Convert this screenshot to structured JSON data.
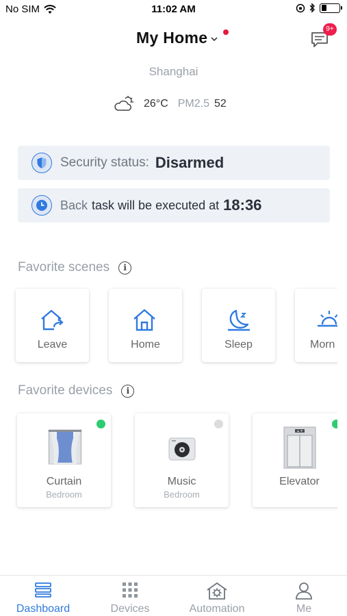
{
  "status_bar": {
    "carrier": "No SIM",
    "time": "11:02 AM",
    "battery_level": 0.3
  },
  "header": {
    "title": "My Home",
    "unread_badge": "9+"
  },
  "location": {
    "city": "Shanghai",
    "weather_icon": "partly-cloudy-icon",
    "temperature": "26°C",
    "pm_label": "PM2.5",
    "pm_value": "52"
  },
  "security": {
    "label": "Security status:",
    "value": "Disarmed"
  },
  "task": {
    "prefix": "Back",
    "text": "task will be executed at",
    "time": "18:36"
  },
  "scenes": {
    "title": "Favorite scenes",
    "items": [
      {
        "label": "Leave",
        "icon": "leave-home-icon"
      },
      {
        "label": "Home",
        "icon": "home-icon"
      },
      {
        "label": "Sleep",
        "icon": "moon-icon"
      },
      {
        "label": "Morn",
        "icon": "sunrise-icon"
      }
    ]
  },
  "devices": {
    "title": "Favorite devices",
    "items": [
      {
        "name": "Curtain",
        "room": "Bedroom",
        "icon": "curtain-icon",
        "status": "online",
        "status_color": "#2ecc71"
      },
      {
        "name": "Music",
        "room": "Bedroom",
        "icon": "music-player-icon",
        "status": "offline",
        "status_color": "#dcdcdc"
      },
      {
        "name": "Elevator",
        "room": "",
        "icon": "elevator-icon",
        "status": "online",
        "status_color": "#2ecc71"
      }
    ]
  },
  "tabs": [
    {
      "label": "Dashboard",
      "icon": "dashboard-icon",
      "active": true
    },
    {
      "label": "Devices",
      "icon": "grid-icon",
      "active": false
    },
    {
      "label": "Automation",
      "icon": "automation-icon",
      "active": false
    },
    {
      "label": "Me",
      "icon": "user-icon",
      "active": false
    }
  ],
  "colors": {
    "accent": "#2f7ae0",
    "badge": "#ee1f4c",
    "card_bg": "#eef1f6",
    "muted_text": "#9aa0a8"
  }
}
